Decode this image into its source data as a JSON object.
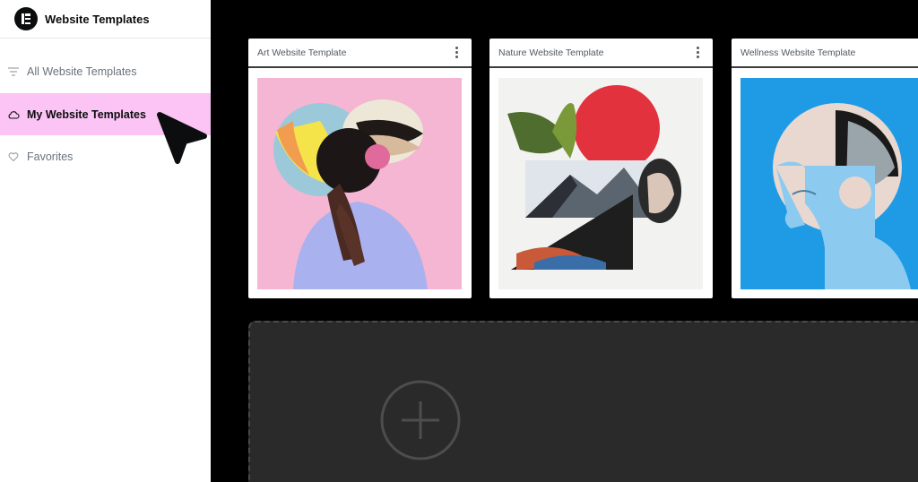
{
  "sidebar": {
    "brand": {
      "title": "Website Templates",
      "logo_icon": "elementor-logo-icon"
    },
    "items": [
      {
        "label": "All Website Templates",
        "icon": "filter-lines-icon",
        "active": false
      },
      {
        "label": "My Website Templates",
        "icon": "cloud-icon",
        "active": true
      },
      {
        "label": "Favorites",
        "icon": "heart-icon",
        "active": false
      }
    ]
  },
  "cards": [
    {
      "title": "Art Website Template",
      "thumbnail": "art-collage-thumbnail"
    },
    {
      "title": "Nature Website Template",
      "thumbnail": "nature-collage-thumbnail"
    },
    {
      "title": "Wellness Website Template",
      "thumbnail": "wellness-collage-thumbnail"
    }
  ],
  "add_zone": {
    "icon": "plus-circle-icon"
  },
  "colors": {
    "active_highlight": "#fbc4f5",
    "main_background": "#000000",
    "drop_zone": "#2a2a2a",
    "muted_text": "#69727d"
  }
}
